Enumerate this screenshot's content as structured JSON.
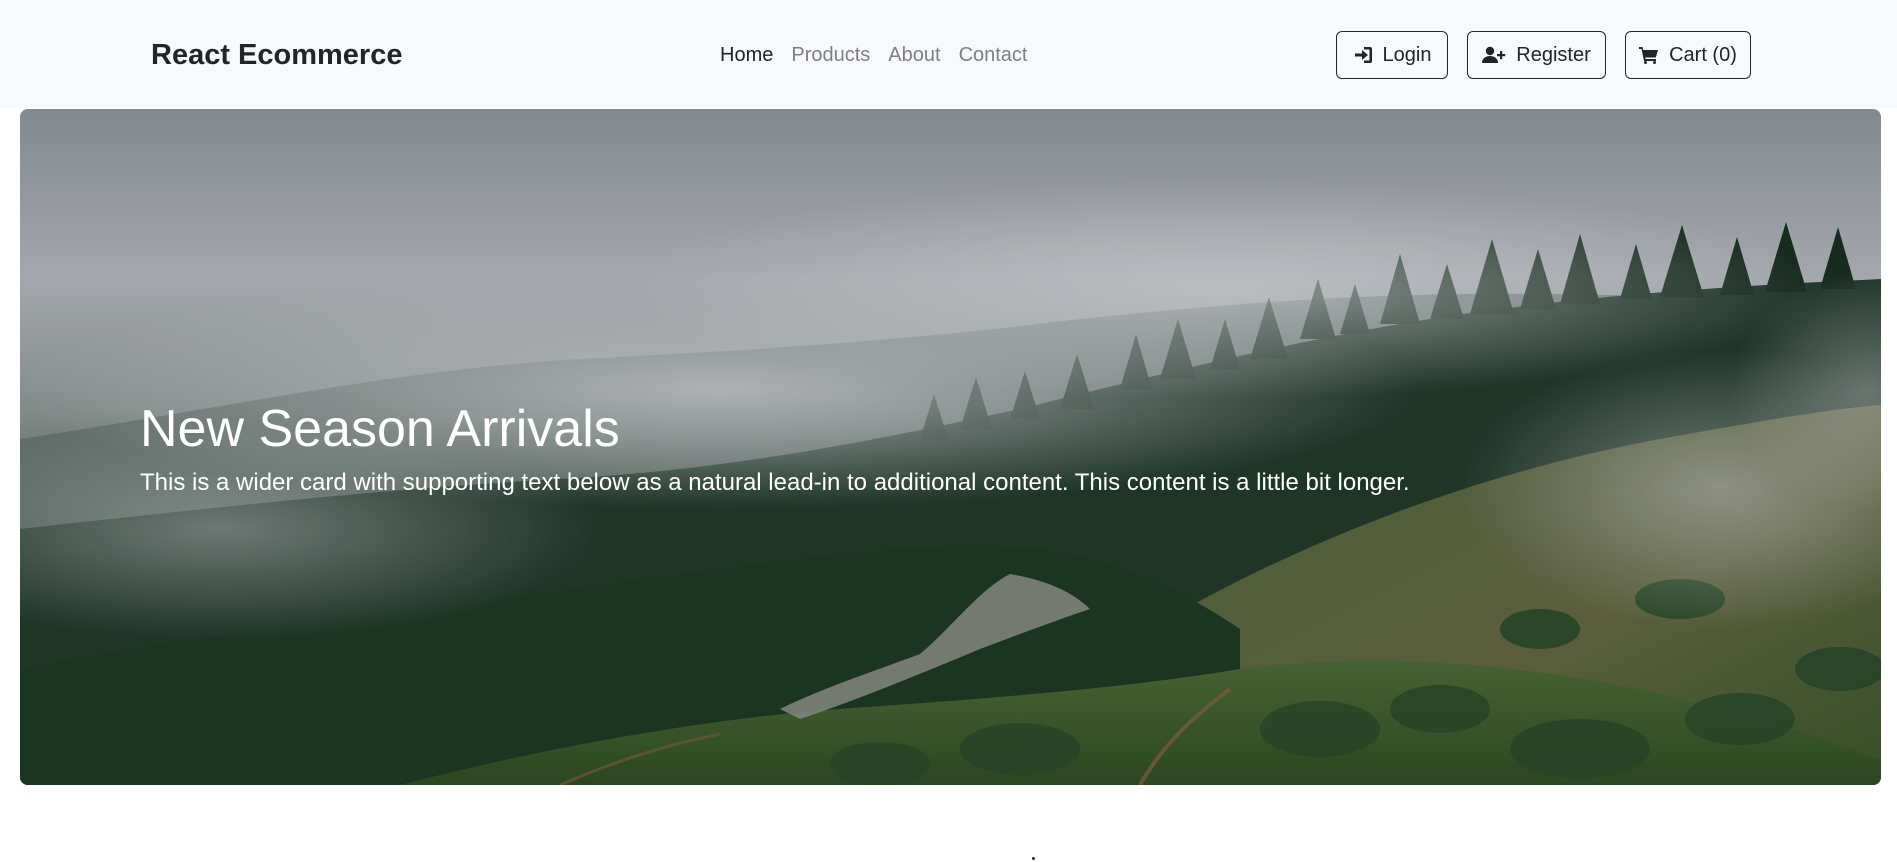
{
  "navbar": {
    "brand": "React Ecommerce",
    "links": [
      {
        "label": "Home",
        "active": true
      },
      {
        "label": "Products",
        "active": false
      },
      {
        "label": "About",
        "active": false
      },
      {
        "label": "Contact",
        "active": false
      }
    ],
    "buttons": {
      "login": {
        "label": "Login",
        "icon": "sign-in-icon"
      },
      "register": {
        "label": "Register",
        "icon": "user-plus-icon"
      },
      "cart": {
        "label": "Cart (0)",
        "icon": "shopping-cart-icon"
      }
    }
  },
  "hero": {
    "title": "New Season Arrivals",
    "text": "This is a wider card with supporting text below as a natural lead-in to additional content. This content is a little bit longer.",
    "image": "misty-forest-hillside"
  },
  "colors": {
    "navbar_bg": "#f8f9fa",
    "text_dark": "#212529",
    "link_muted": "#7d7f82",
    "hero_text": "#ffffff"
  }
}
